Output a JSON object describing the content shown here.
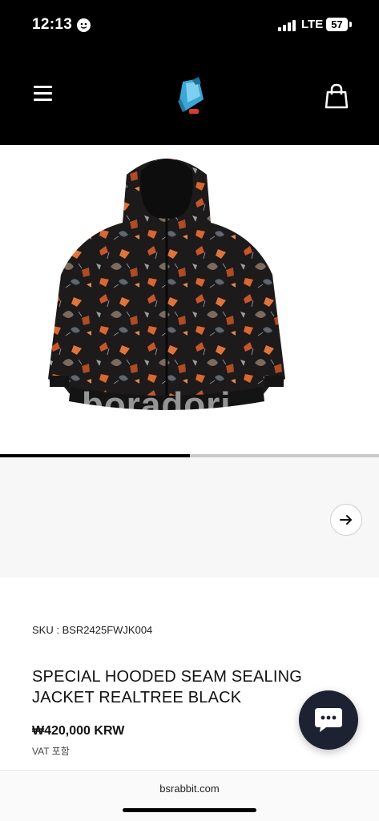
{
  "status_bar": {
    "time": "12:13",
    "network": "LTE",
    "battery": "57"
  },
  "header": {
    "menu_icon": "hamburger-menu-icon",
    "logo_icon": "brand-logo",
    "cart_icon": "shopping-bag-icon"
  },
  "gallery": {
    "watermark": "boradori",
    "progress": 0.5,
    "next_icon": "arrow-right-icon"
  },
  "product": {
    "sku": "SKU : BSR2425FWJK004",
    "title": "SPECIAL HOODED SEAM SEALING JACKET REALTREE BLACK",
    "price": "₩420,000 KRW",
    "vat_note": "VAT 포함"
  },
  "chat": {
    "icon": "chat-bubble-icon"
  },
  "footer": {
    "url": "bsrabbit.com"
  },
  "colors": {
    "header_bg": "#000000",
    "chat_bg": "#1d2233",
    "progress_fill": "#000000",
    "progress_track": "#c9c9c9"
  }
}
